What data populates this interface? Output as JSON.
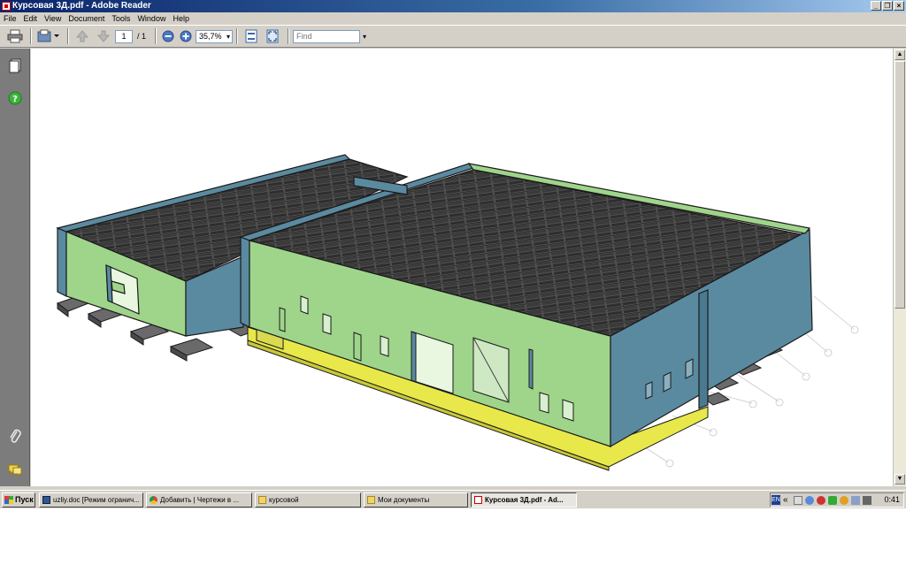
{
  "window": {
    "title": "Курсовая 3Д.pdf - Adobe Reader",
    "controls": {
      "minimize": "_",
      "restore": "❐",
      "close": "×"
    }
  },
  "menu": [
    "File",
    "Edit",
    "View",
    "Document",
    "Tools",
    "Window",
    "Help"
  ],
  "toolbar": {
    "page_current": "1",
    "page_total": "/ 1",
    "zoom": "35,7%",
    "find_placeholder": "Find"
  },
  "taskbar": {
    "start": "Пуск",
    "tasks": [
      {
        "label": "uzliy.doc [Режим огранич...",
        "icon": "word-icon",
        "active": false
      },
      {
        "label": "Добавить | Чертежи в ...",
        "icon": "chrome-icon",
        "active": false
      },
      {
        "label": "курсовой",
        "icon": "folder-icon",
        "active": false
      },
      {
        "label": "Мои документы",
        "icon": "folder-icon",
        "active": false
      },
      {
        "label": "Курсовая 3Д.pdf - Ad...",
        "icon": "pdf-icon",
        "active": true
      }
    ],
    "language": "EN",
    "chevron": "«",
    "clock": "0:41"
  },
  "colors": {
    "wall_green": "#9fd58a",
    "wall_blue": "#5a8aa0",
    "foundation_yellow": "#e8e84a",
    "roof_dark": "#4a4a4a",
    "nav_pane": "#7c7c7c"
  }
}
